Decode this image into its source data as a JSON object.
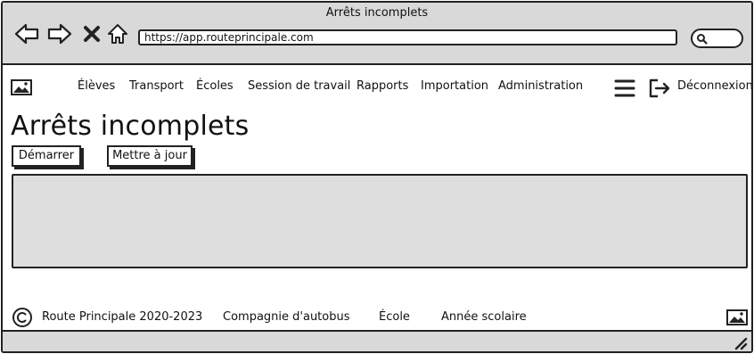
{
  "window": {
    "title": "Arrêts incomplets"
  },
  "browser": {
    "url": "https://app.routeprincipale.com",
    "nav_icons": [
      "back-arrow-icon",
      "forward-arrow-icon",
      "close-x-icon",
      "home-icon"
    ]
  },
  "navbar": {
    "items": [
      {
        "label": "Élèves"
      },
      {
        "label": "Transport"
      },
      {
        "label": "Écoles"
      },
      {
        "label": "Session de travail"
      },
      {
        "label": "Rapports"
      },
      {
        "label": "Importation"
      },
      {
        "label": "Administration"
      }
    ],
    "logout_label": "Déconnexion"
  },
  "page": {
    "title": "Arrêts incomplets",
    "buttons": {
      "start": "Démarrer",
      "update": "Mettre à jour"
    }
  },
  "footer": {
    "copyright": "Route Principale 2020-2023",
    "links": [
      {
        "label": "Compagnie d'autobus"
      },
      {
        "label": "École"
      },
      {
        "label": "Année scolaire"
      }
    ]
  },
  "colors": {
    "chrome": "#d9d9d9",
    "content_placeholder": "#dedede",
    "stroke": "#222222"
  }
}
